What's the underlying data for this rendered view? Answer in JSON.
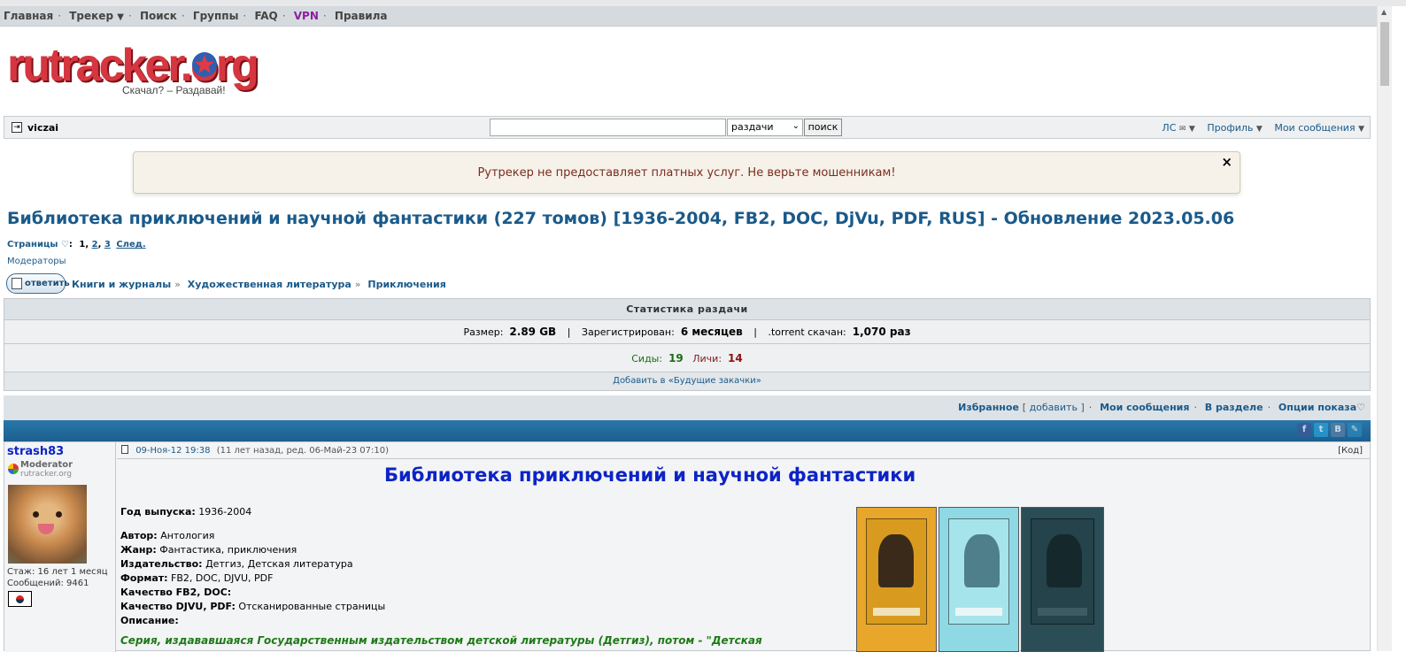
{
  "topnav": {
    "items": [
      "Главная",
      "Трекер",
      "Поиск",
      "Группы",
      "FAQ",
      "VPN",
      "Правила"
    ]
  },
  "logo": {
    "text": "rutracker.org",
    "tagline": "Скачал? – Раздавай!"
  },
  "userbar": {
    "username": "viczai",
    "search_value": "",
    "search_scope": "раздачи",
    "search_button": "поиск",
    "menu": [
      "ЛС",
      "Профиль",
      "Мои сообщения"
    ]
  },
  "alert": {
    "text": "Рутрекер не предоставляет платных услуг. Не верьте мошенникам!",
    "close": "×"
  },
  "topic": {
    "title": "Библиотека приключений и научной фантастики (227 томов) [1936-2004, FB2, DOC, DjVu, PDF, RUS] - Обновление 2023.05.06",
    "pages_label": "Страницы",
    "current_page": "1",
    "pages": [
      "2",
      "3"
    ],
    "next": "След.",
    "moderators": "Модераторы",
    "reply": "ответить",
    "breadcrumbs": [
      "Книги и журналы",
      "Художественная литература",
      "Приключения"
    ]
  },
  "stats": {
    "title": "Статистика раздачи",
    "size_label": "Размер:",
    "size_value": "2.89 GB",
    "registered_label": "Зарегистрирован:",
    "registered_value": "6 месяцев",
    "downloaded_label": ".torrent скачан:",
    "downloaded_value": "1,070 раз",
    "seeds_label": "Сиды:",
    "seeds_value": "19",
    "leech_label": "Личи:",
    "leech_value": "14",
    "add_future": "Добавить в «Будущие закачки»"
  },
  "favbar": {
    "favorites": "Избранное",
    "add": "добавить",
    "my_posts": "Мои сообщения",
    "in_section": "В разделе",
    "options": "Опции показа"
  },
  "post": {
    "author": "strash83",
    "rank": "Moderator",
    "rank_site": "rutracker.org",
    "tenure": "Стаж: 16 лет 1 месяц",
    "posts": "Сообщений: 9461",
    "date": "09-Ноя-12 19:38",
    "edited": "(11 лет назад, ред. 06-Май-23 07:10)",
    "code": "[Код]",
    "title": "Библиотека приключений и научной фантастики",
    "year_label": "Год выпуска:",
    "year": "1936-2004",
    "author_label": "Автор:",
    "author_value": "Антология",
    "genre_label": "Жанр:",
    "genre": "Фантастика, приключения",
    "publisher_label": "Издательство:",
    "publisher": "Детгиз, Детская литература",
    "format_label": "Формат:",
    "format": "FB2, DOC, DJVU, PDF",
    "quality_fb2_label": "Качество FB2, DOC:",
    "quality_djvu_label": "Качество DJVU, PDF:",
    "quality_djvu": "Отсканированные страницы",
    "description_label": "Описание:",
    "description": "Серия, издававшаяся Государственным издательством детской литературы (Детгиз), потом - \"Детская"
  },
  "colors": {
    "link": "#1a5a8a",
    "title_blue": "#0c23c6",
    "alert_text": "#7a2c1d",
    "seeds": "#1d6b16",
    "leech": "#8b1414",
    "band": "#1b5f8e"
  }
}
